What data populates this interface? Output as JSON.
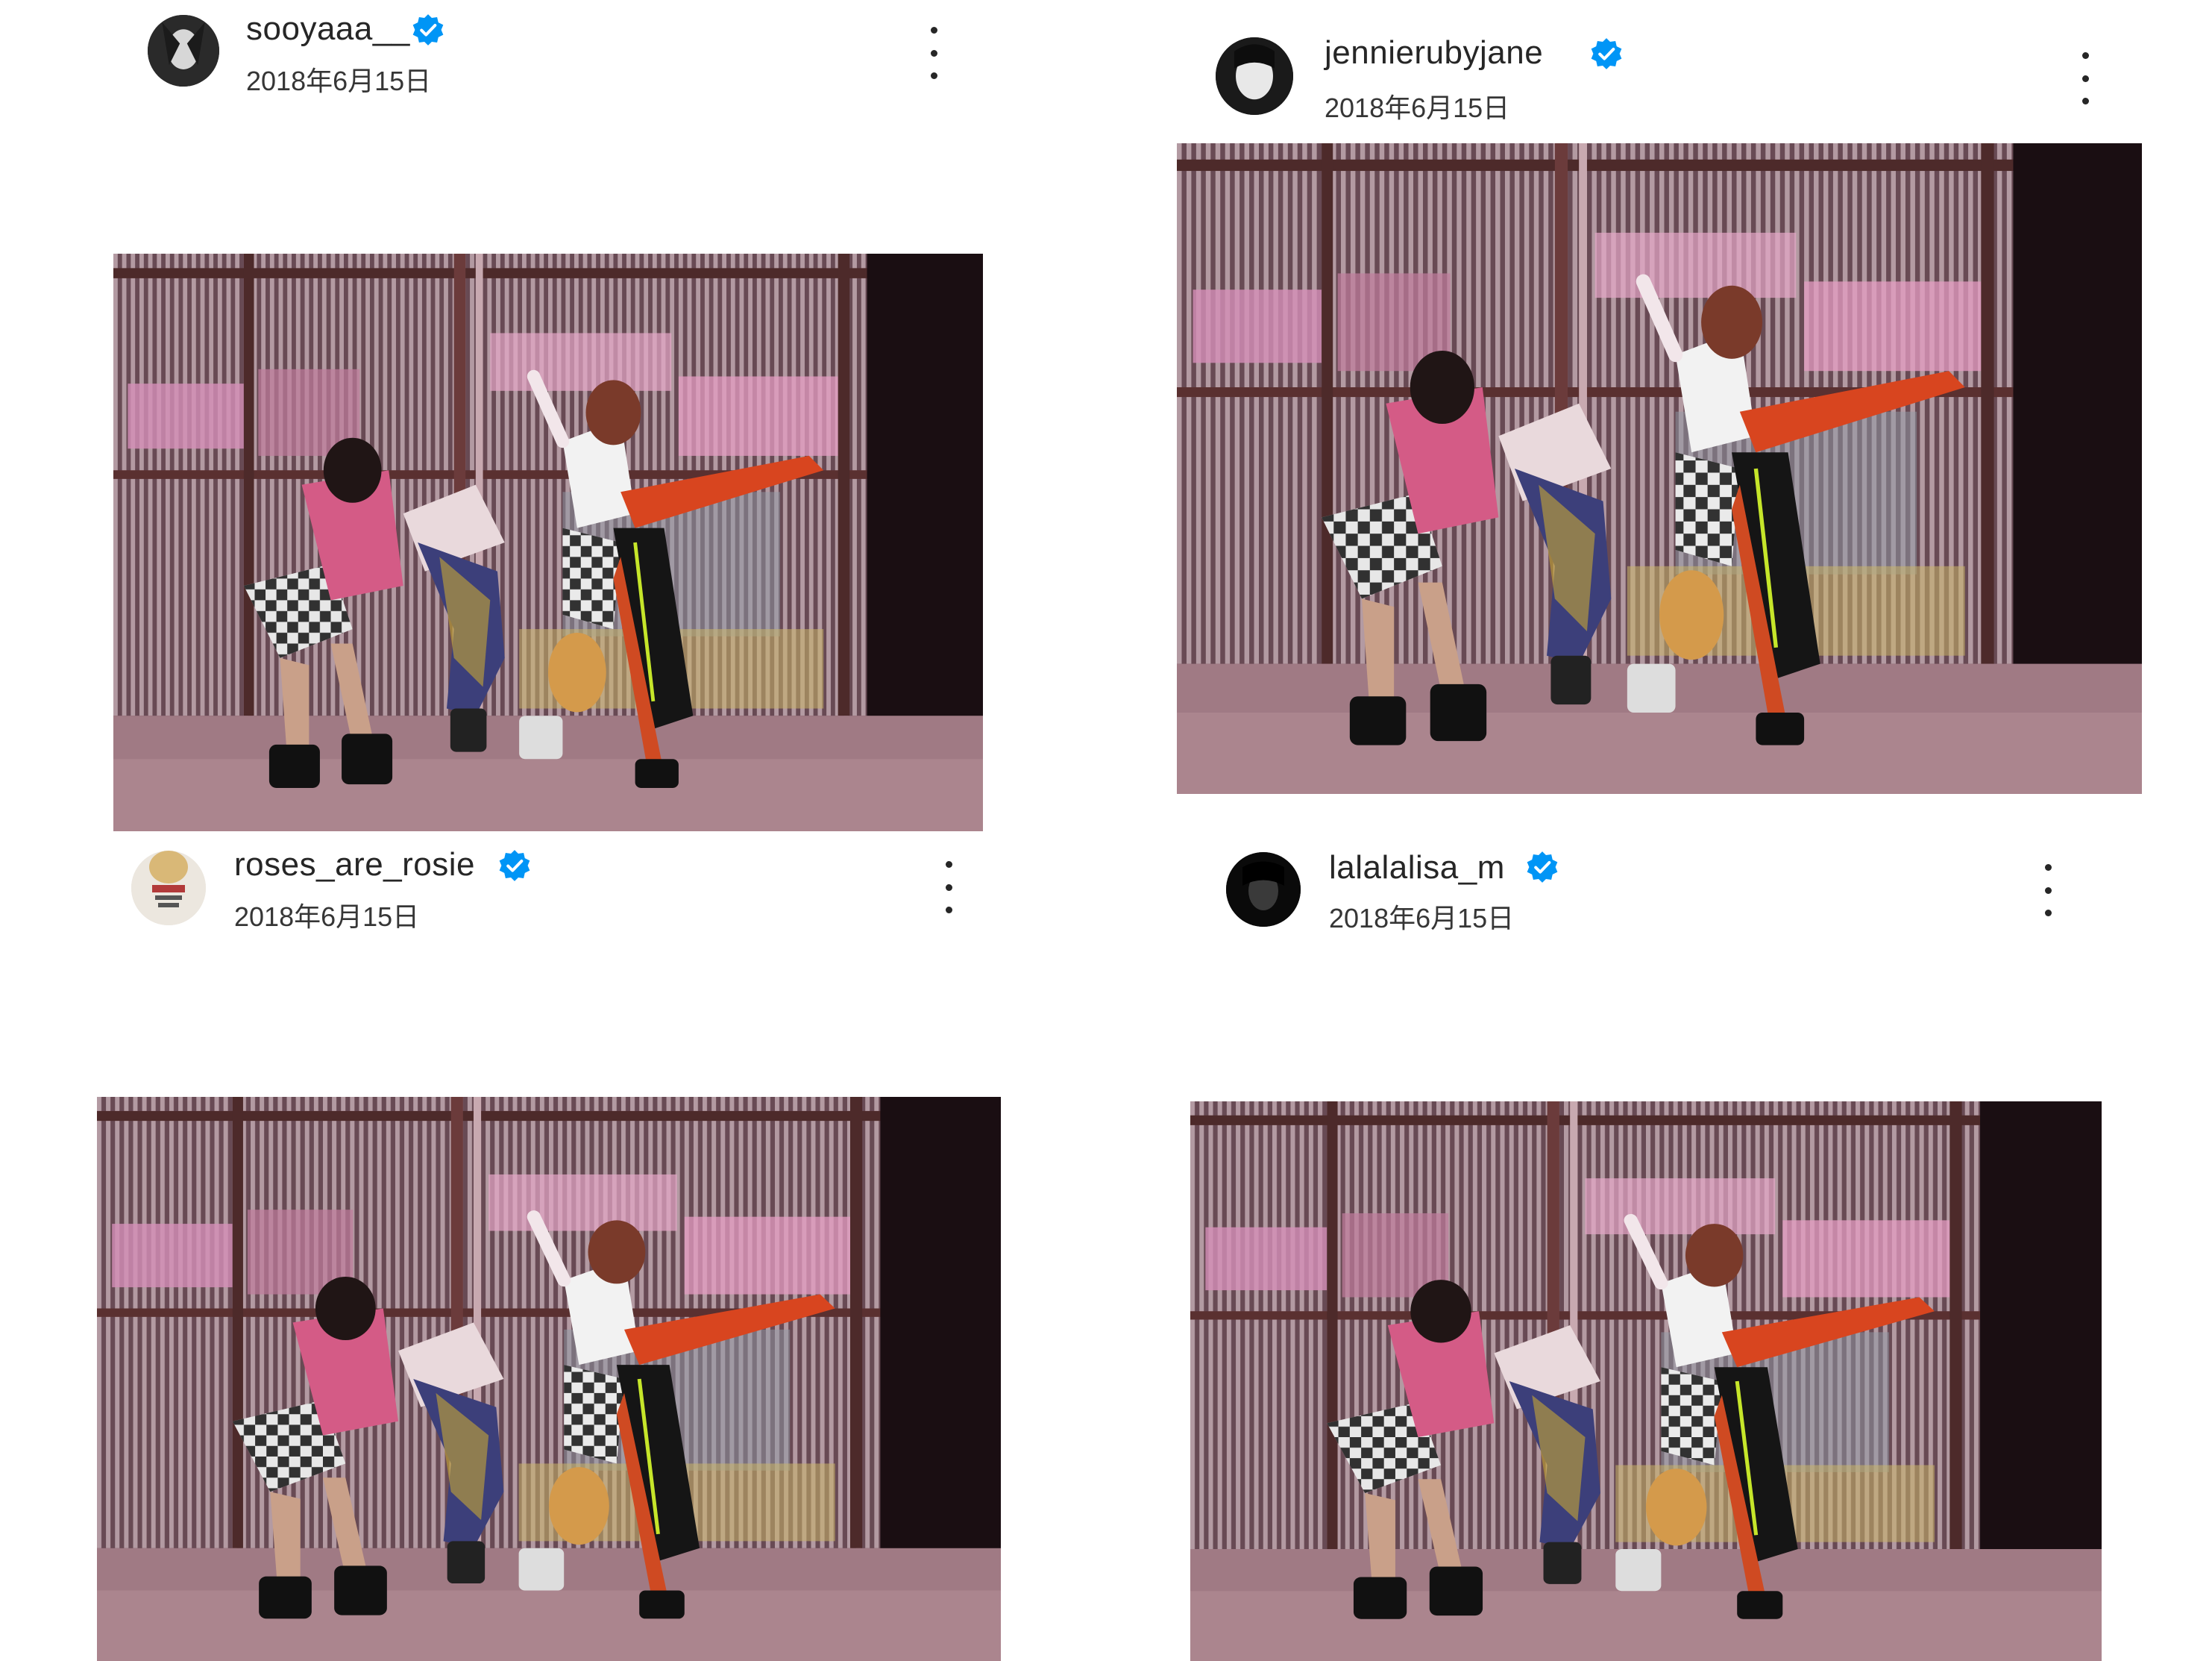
{
  "posts": [
    {
      "username": "sooyaaa__",
      "date": "2018年6月15日",
      "avatar_icon": "avatar-sooyaaa",
      "photo_alt": "group photo"
    },
    {
      "username": "jennierubyjane",
      "date": "2018年6月15日",
      "avatar_icon": "avatar-jennie",
      "photo_alt": "group photo"
    },
    {
      "username": "roses_are_rosie",
      "date": "2018年6月15日",
      "avatar_icon": "avatar-rosie",
      "photo_alt": "group photo"
    },
    {
      "username": "lalalalisa_m",
      "date": "2018年6月15日",
      "avatar_icon": "avatar-lisa",
      "photo_alt": "group photo"
    }
  ],
  "icons": {
    "verified": "verified-badge-icon",
    "more": "more-options-icon"
  },
  "colors": {
    "verified_blue": "#0095f6",
    "text": "#262626"
  }
}
